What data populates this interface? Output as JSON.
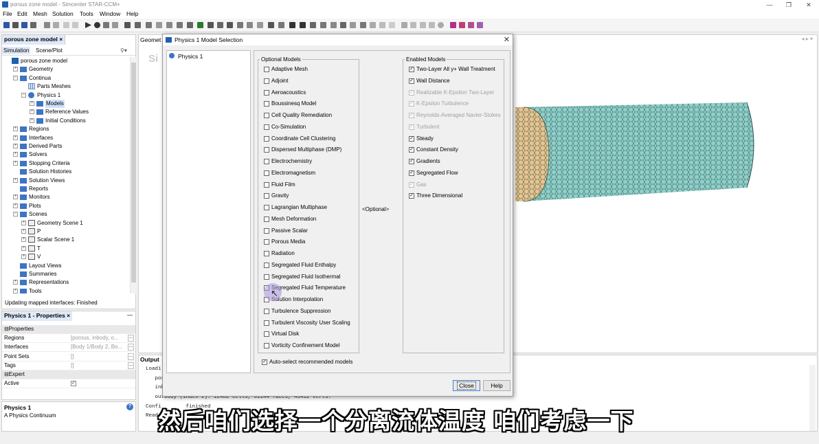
{
  "window": {
    "title": "porous zone model - Simcenter STAR-CCM+",
    "min": "—",
    "restore": "❐",
    "close": "✕"
  },
  "menu": [
    "File",
    "Edit",
    "Mesh",
    "Solution",
    "Tools",
    "Window",
    "Help"
  ],
  "left_panel": {
    "tab": "porous zone model ×",
    "subtabs": [
      "Simulation",
      "Scene/Plot"
    ],
    "tree": [
      {
        "label": "porous zone model",
        "indent": 0,
        "icon": "sim",
        "exp": ""
      },
      {
        "label": "Geometry",
        "indent": 1,
        "icon": "folder",
        "exp": "+"
      },
      {
        "label": "Continua",
        "indent": 1,
        "icon": "folder",
        "exp": "−"
      },
      {
        "label": "Parts Meshes",
        "indent": 2,
        "icon": "grid",
        "exp": ""
      },
      {
        "label": "Physics 1",
        "indent": 2,
        "icon": "sphere",
        "exp": "−"
      },
      {
        "label": "Models",
        "indent": 3,
        "icon": "folder",
        "exp": "+",
        "selected": true
      },
      {
        "label": "Reference Values",
        "indent": 3,
        "icon": "folder",
        "exp": "+"
      },
      {
        "label": "Initial Conditions",
        "indent": 3,
        "icon": "folder",
        "exp": "+"
      },
      {
        "label": "Regions",
        "indent": 1,
        "icon": "folder",
        "exp": "+"
      },
      {
        "label": "Interfaces",
        "indent": 1,
        "icon": "folder",
        "exp": "+"
      },
      {
        "label": "Derived Parts",
        "indent": 1,
        "icon": "folder",
        "exp": "+"
      },
      {
        "label": "Solvers",
        "indent": 1,
        "icon": "folder",
        "exp": "+"
      },
      {
        "label": "Stopping Criteria",
        "indent": 1,
        "icon": "folder",
        "exp": "+"
      },
      {
        "label": "Solution Histories",
        "indent": 1,
        "icon": "folder",
        "exp": ""
      },
      {
        "label": "Solution Views",
        "indent": 1,
        "icon": "folder",
        "exp": "+"
      },
      {
        "label": "Reports",
        "indent": 1,
        "icon": "folder",
        "exp": ""
      },
      {
        "label": "Monitors",
        "indent": 1,
        "icon": "folder",
        "exp": "+"
      },
      {
        "label": "Plots",
        "indent": 1,
        "icon": "folder",
        "exp": "+"
      },
      {
        "label": "Scenes",
        "indent": 1,
        "icon": "folder",
        "exp": "−"
      },
      {
        "label": "Geometry Scene 1",
        "indent": 2,
        "icon": "scene",
        "exp": "+"
      },
      {
        "label": "P",
        "indent": 2,
        "icon": "scene",
        "exp": "+"
      },
      {
        "label": "Scalar Scene 1",
        "indent": 2,
        "icon": "scene",
        "exp": "+"
      },
      {
        "label": "T",
        "indent": 2,
        "icon": "scene",
        "exp": "+"
      },
      {
        "label": "V",
        "indent": 2,
        "icon": "scene",
        "exp": "+"
      },
      {
        "label": "Layout Views",
        "indent": 1,
        "icon": "folder",
        "exp": ""
      },
      {
        "label": "Summaries",
        "indent": 1,
        "icon": "folder",
        "exp": ""
      },
      {
        "label": "Representations",
        "indent": 1,
        "icon": "folder",
        "exp": "+"
      },
      {
        "label": "Tools",
        "indent": 1,
        "icon": "folder",
        "exp": "+"
      }
    ],
    "status": "Updating mapped interfaces: Finished"
  },
  "properties": {
    "tab": "Physics 1 - Properties ×",
    "minimize": "—",
    "rows": [
      {
        "name": "Properties",
        "value": "",
        "section": true,
        "prefix": "⊟"
      },
      {
        "name": "Regions",
        "value": "[porous, inbody, o...",
        "btn": "..."
      },
      {
        "name": "Interfaces",
        "value": "[Body 1/Body 2, Bo...",
        "btn": "..."
      },
      {
        "name": "Point Sets",
        "value": "[]",
        "btn": "..."
      },
      {
        "name": "Tags",
        "value": "[]",
        "btn": "..."
      },
      {
        "name": "Expert",
        "value": "",
        "section": true,
        "prefix": "⊟"
      },
      {
        "name": "Active",
        "value": "✓",
        "checkbox": true
      }
    ]
  },
  "description": {
    "title": "Physics 1",
    "text": "A Physics Continuum",
    "help": "?"
  },
  "viewport": {
    "tab": "Geomet",
    "ghost_text": "Si",
    "tab_arrows": "◂ ▸ ▾",
    "mesh_colors": {
      "porous": "#e8c48e",
      "outer": "#8fcfc9",
      "edge": "#2c4f4c"
    }
  },
  "output": {
    "tab": "Output",
    "lines": [
      "Loadi",
      "   por",
      "   inb",
      "   outbody (index 2): 12482 cells, 61144 faces, 43412 verts.",
      "Confi        finished",
      "Read"
    ]
  },
  "subtitle": "然后咱们选择一个分离流体温度  咱们考虑一下",
  "dialog": {
    "title": "Physics 1 Model Selection",
    "close_x": "✕",
    "physics_item": "Physics 1",
    "optional_title": "Optional Models",
    "enabled_title": "Enabled Models",
    "optional_mid": "<Optional>",
    "optional_models": [
      "Adaptive Mesh",
      "Adjoint",
      "Aeroacoustics",
      "Boussinesq Model",
      "Cell Quality Remediation",
      "Co-Simulation",
      "Coordinate Cell Clustering",
      "Dispersed Multiphase (DMP)",
      "Electrochemistry",
      "Electromagnetism",
      "Fluid Film",
      "Gravity",
      "Lagrangian Multiphase",
      "Mesh Deformation",
      "Passive Scalar",
      "Porous Media",
      "Radiation",
      "Segregated Fluid Enthalpy",
      "Segregated Fluid Isothermal",
      "Segregated Fluid Temperature",
      "Solution Interpolation",
      "Turbulence Suppression",
      "Turbulent Viscosity User Scaling",
      "Virtual Disk",
      "Vorticity Confinement Model"
    ],
    "enabled_models": [
      {
        "label": "Two-Layer All y+ Wall Treatment",
        "disabled": false
      },
      {
        "label": "Wall Distance",
        "disabled": false
      },
      {
        "label": "Realizable K-Epsilon Two-Layer",
        "disabled": true
      },
      {
        "label": "K-Epsilon Turbulence",
        "disabled": true
      },
      {
        "label": "Reynolds-Averaged Navier-Stokes",
        "disabled": true
      },
      {
        "label": "Turbulent",
        "disabled": true
      },
      {
        "label": "Steady",
        "disabled": false
      },
      {
        "label": "Constant Density",
        "disabled": false
      },
      {
        "label": "Gradients",
        "disabled": false
      },
      {
        "label": "Segregated Flow",
        "disabled": false
      },
      {
        "label": "Gas",
        "disabled": true
      },
      {
        "label": "Three Dimensional",
        "disabled": false
      }
    ],
    "auto_select": "Auto-select recommended models",
    "close_button": "Close",
    "help_button": "Help"
  }
}
